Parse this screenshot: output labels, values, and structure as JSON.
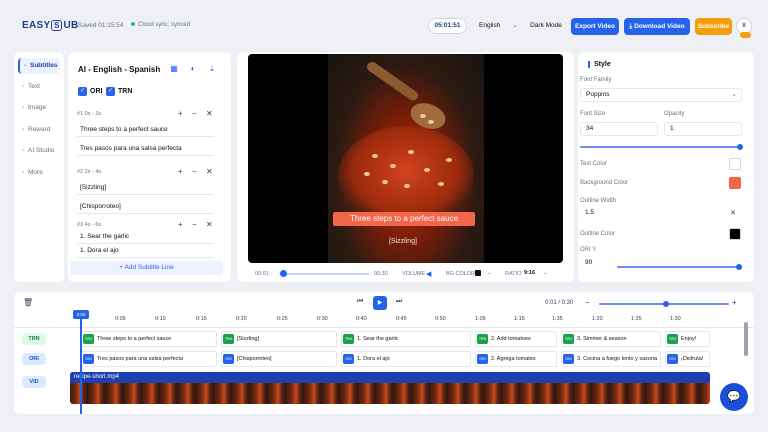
{
  "app": {
    "logo": "EASY",
    "logo_s": "S",
    "logo_end": "UB",
    "saved": "Saved 01:15:54",
    "sync": "Cloud sync: synced",
    "timer": "05:01:51",
    "language": "English",
    "dark_mode": "Dark Mode",
    "export": "Export Video",
    "download": "Download Video",
    "subscribe": "Subscribe",
    "avatar": "8"
  },
  "nav": {
    "items": [
      "Subtitles",
      "Text",
      "Image",
      "Reward",
      "AI Studio",
      "More"
    ]
  },
  "subtitles": {
    "title": "AI - English - Spanish",
    "ori_label": "ORI",
    "trn_label": "TRN",
    "add_line": "+ Add Subtitle Line",
    "cues": [
      {
        "meta": "#1   0s - 2s",
        "ori": "Three steps to a perfect sauce",
        "trn": "Tres pasos para una salsa perfecta"
      },
      {
        "meta": "#2   2s - 4s",
        "ori": "[Sizzling]",
        "trn": "[Chisporroteo]"
      },
      {
        "meta": "#3   4s - 6s",
        "ori": "1. Sear the garlic",
        "trn": "1. Dora el ajo"
      }
    ]
  },
  "player": {
    "caption_main": "Three steps to a perfect sauce",
    "caption_secondary": "[Sizzling]",
    "current": "00:01",
    "duration": "00:30",
    "volume_label": "VOLUME",
    "bg_color_label": "BG COLOR",
    "ratio_label": "RATIO",
    "ratio_value": "9:16",
    "progress": 0.03
  },
  "style": {
    "title": "Style",
    "font_family_label": "Font Family",
    "font_family": "Poppins",
    "font_size_label": "Font Size",
    "font_size": "34",
    "opacity_label": "Opacity",
    "opacity": "1",
    "text_color_label": "Text Color",
    "bg_color_label": "Background Color",
    "outline_width_label": "Outline Width",
    "outline_width": "1.5",
    "outline_color_label": "Outline Color",
    "ori_y_label": "ORI Y",
    "ori_y": "90",
    "colors": {
      "text": "#ffffff",
      "background": "#f2664a",
      "outline": "#000000"
    }
  },
  "timeline": {
    "time": "0:01 / 0:30",
    "playhead": "0:00",
    "ticks": [
      "0:05",
      "0:10",
      "0:15",
      "0:20",
      "0:25",
      "0:30",
      "0:40",
      "0:45",
      "0:50",
      "1:05",
      "1:15",
      "1:35",
      "1:20",
      "1:25",
      "1:30"
    ],
    "track_labels": {
      "trn": "TRN",
      "ori": "ORI",
      "vid": "VID"
    },
    "trn_clips": [
      "Three steps to a perfect sauce",
      "[Sizzling]",
      "1. Sear the garlic",
      "2. Add tomatoes",
      "3. Simmer & season",
      "Enjoy!"
    ],
    "ori_clips": [
      "Tres pasos para una salsa perfecta",
      "[Chisporroteo]",
      "1. Dora el ajo",
      "2. Agrega tomates",
      "3. Cocina a fuego lento y sazona",
      "¡Disfruta!"
    ],
    "video_clip": "recipe-short.mp4",
    "tag_trn": "TRN",
    "tag_ori": "ORI",
    "zoom_minus": "−",
    "zoom_plus": "+"
  }
}
